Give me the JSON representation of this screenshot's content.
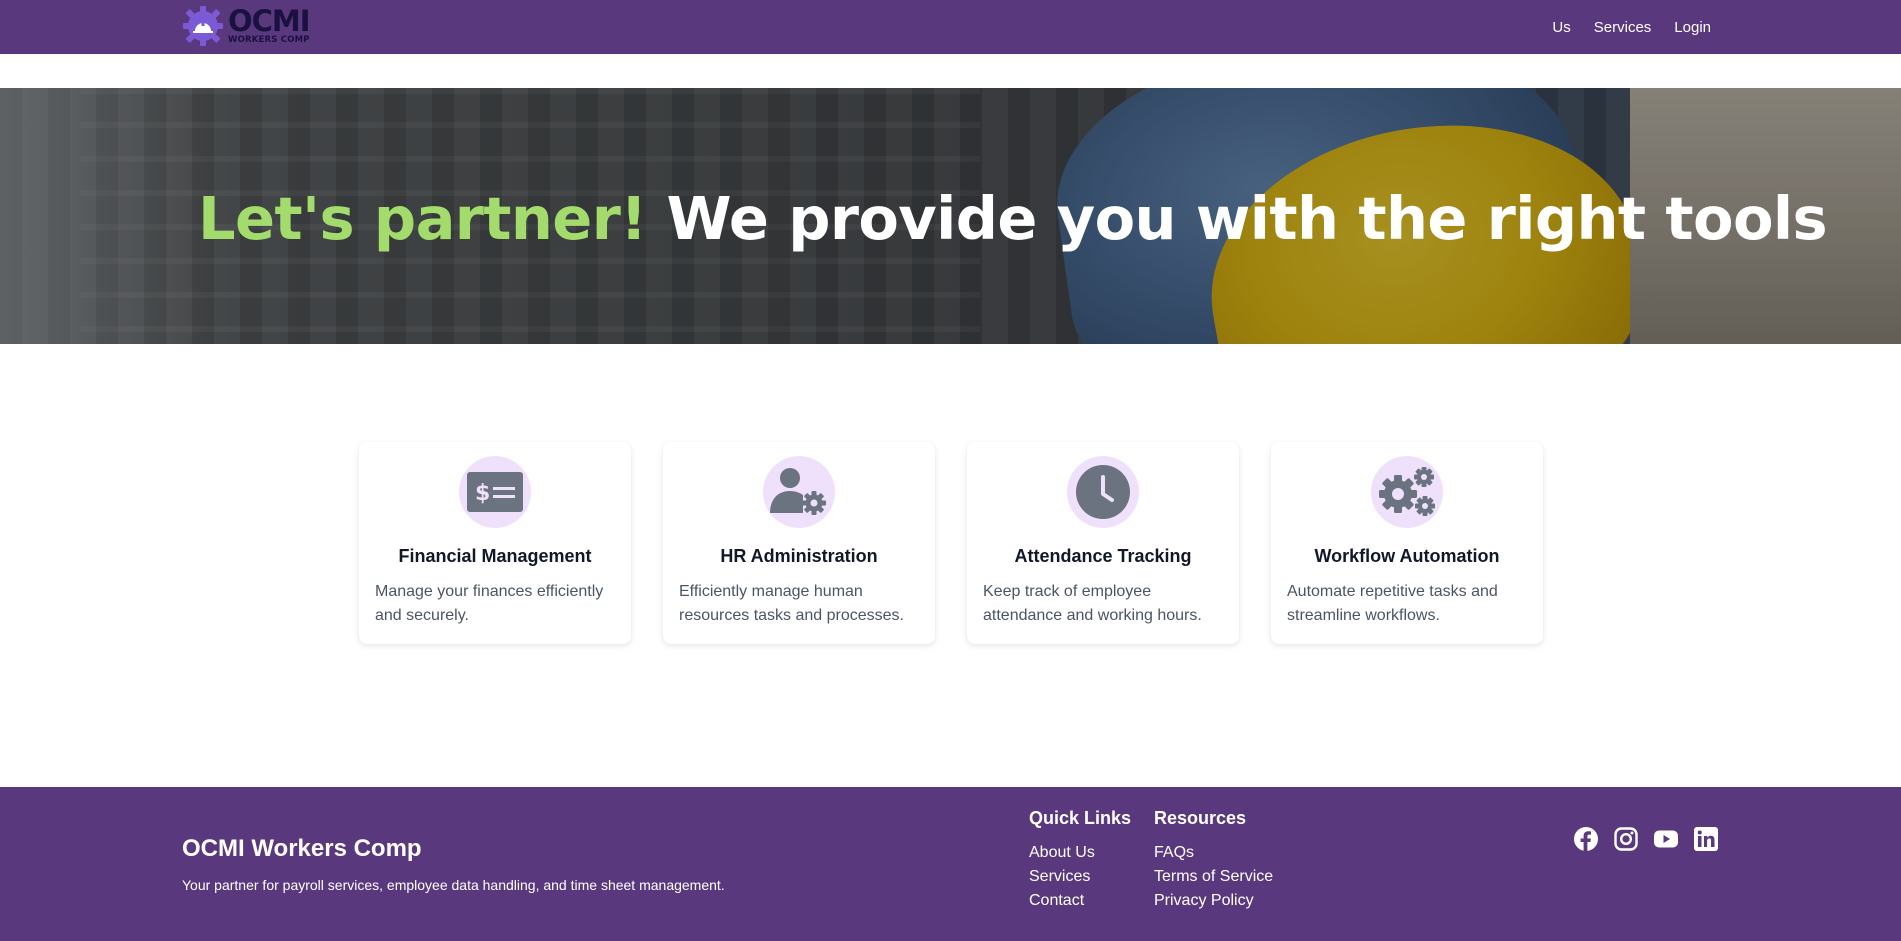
{
  "colors": {
    "brand_purple": "#5a387d",
    "accent_green": "#a3dc6c",
    "icon_circle": "#efe0fc",
    "icon_gray": "#6b7280"
  },
  "navbar": {
    "logo": {
      "name": "OCMI",
      "sub": "WORKERS COMP",
      "icon": "gear-helmet-icon"
    },
    "links": [
      {
        "label": "Us"
      },
      {
        "label": "Services"
      },
      {
        "label": "Login"
      }
    ]
  },
  "hero": {
    "accent": "Let's partner!",
    "title": "We provide you with the right tools"
  },
  "features": [
    {
      "icon": "money-check-icon",
      "title": "Financial Management",
      "text": "Manage your finances efficiently and securely."
    },
    {
      "icon": "user-gear-icon",
      "title": "HR Administration",
      "text": "Efficiently manage human resources tasks and processes."
    },
    {
      "icon": "clock-icon",
      "title": "Attendance Tracking",
      "text": "Keep track of employee attendance and working hours."
    },
    {
      "icon": "gears-icon",
      "title": "Workflow Automation",
      "text": "Automate repetitive tasks and streamline workflows."
    }
  ],
  "footer": {
    "brand": "OCMI Workers Comp",
    "tagline": "Your partner for payroll services, employee data handling, and time sheet management.",
    "quick_links": {
      "heading": "Quick Links",
      "items": [
        "About Us",
        "Services",
        "Contact"
      ]
    },
    "resources": {
      "heading": "Resources",
      "items": [
        "FAQs",
        "Terms of Service",
        "Privacy Policy"
      ]
    },
    "social": [
      "facebook-icon",
      "instagram-icon",
      "youtube-icon",
      "linkedin-icon"
    ]
  }
}
